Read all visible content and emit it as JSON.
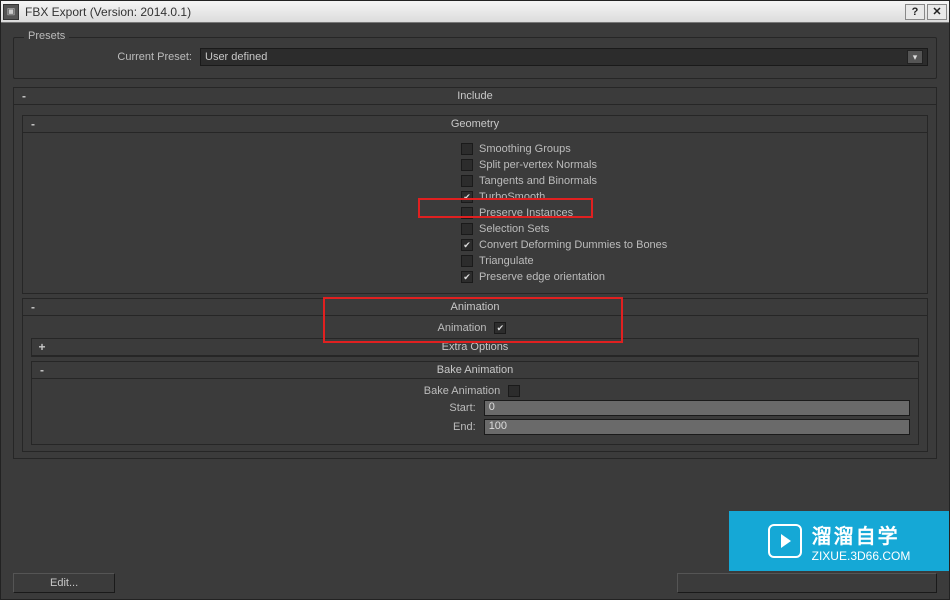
{
  "window": {
    "title": "FBX Export (Version: 2014.0.1)"
  },
  "presets": {
    "legend": "Presets",
    "current_label": "Current Preset:",
    "current_value": "User defined"
  },
  "sections": {
    "include": {
      "title": "Include",
      "toggle": "-"
    },
    "geometry": {
      "title": "Geometry",
      "toggle": "-"
    },
    "animation_sec": {
      "title": "Animation",
      "toggle": "-"
    },
    "extra": {
      "title": "Extra Options",
      "toggle": "+"
    },
    "bake": {
      "title": "Bake Animation",
      "toggle": "-"
    }
  },
  "geometry_opts": [
    {
      "label": "Smoothing Groups",
      "checked": false
    },
    {
      "label": "Split per-vertex Normals",
      "checked": false
    },
    {
      "label": "Tangents and Binormals",
      "checked": false
    },
    {
      "label": "TurboSmooth",
      "checked": true
    },
    {
      "label": "Preserve Instances",
      "checked": false
    },
    {
      "label": "Selection Sets",
      "checked": false
    },
    {
      "label": "Convert Deforming Dummies to Bones",
      "checked": true
    },
    {
      "label": "Triangulate",
      "checked": false
    },
    {
      "label": "Preserve edge orientation",
      "checked": true
    }
  ],
  "animation": {
    "label": "Animation",
    "checked": true
  },
  "bake": {
    "label": "Bake Animation",
    "checked": false,
    "start_label": "Start:",
    "start_value": "0",
    "end_label": "End:",
    "end_value": "100"
  },
  "footer": {
    "edit": "Edit..."
  },
  "watermark": {
    "brand": "溜溜自学",
    "url": "ZIXUE.3D66.COM"
  }
}
